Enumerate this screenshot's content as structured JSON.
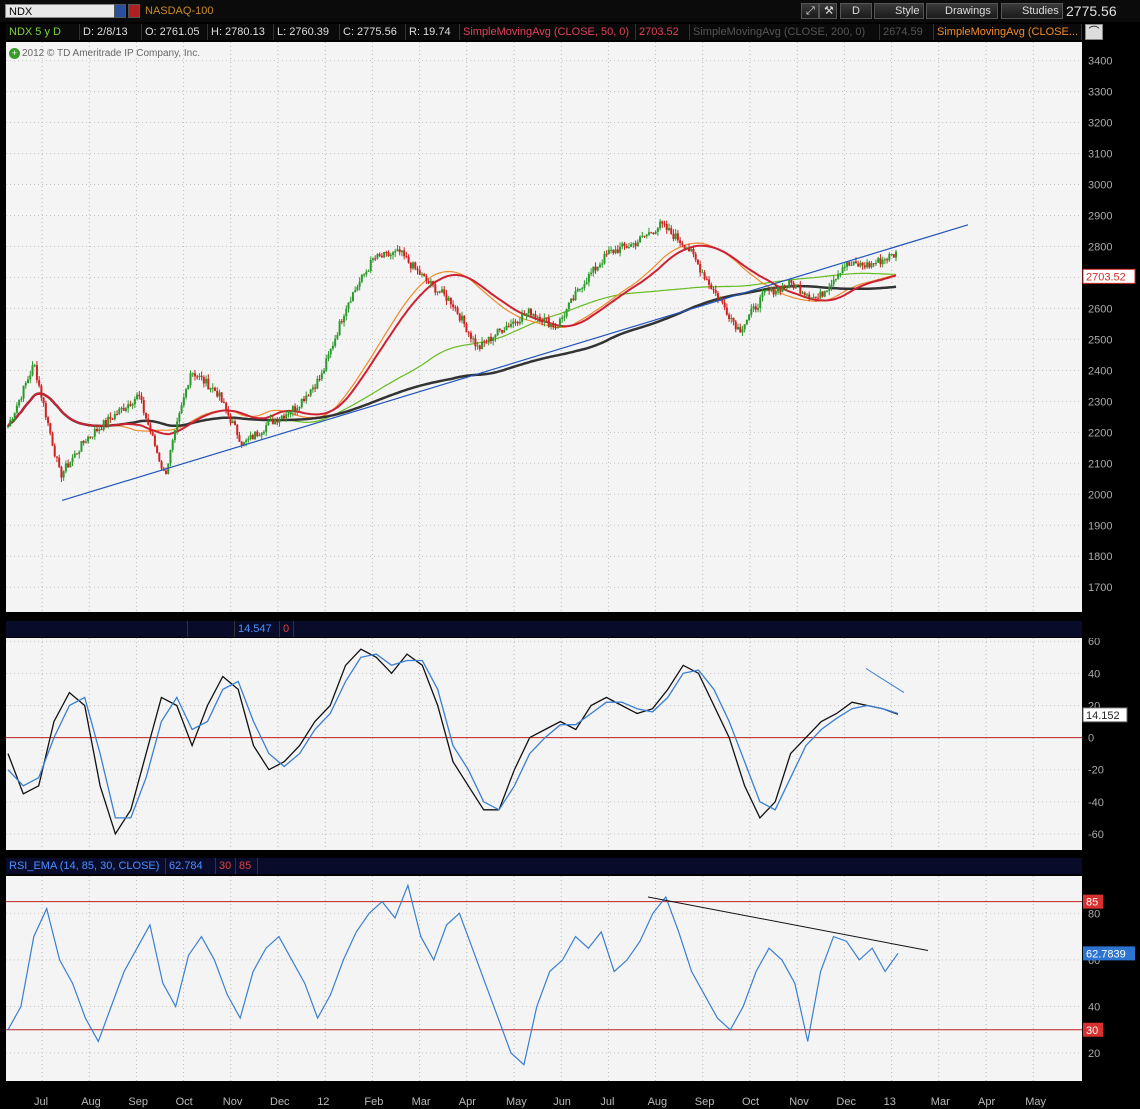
{
  "toolbar": {
    "symbol": "NDX",
    "symbol_name": "NASDAQ-100",
    "aggregation_btn": "D",
    "style_label": "Style",
    "drawings_label": "Drawings",
    "studies_label": "Studies",
    "last_price": "2775.56"
  },
  "quote_bar": {
    "symbol_period": "NDX 5 y D",
    "date": "D: 2/8/13",
    "open": "O: 2761.05",
    "high": "H: 2780.13",
    "low": "L: 2760.39",
    "close": "C: 2775.56",
    "range": "R: 19.74",
    "sma50_label": "SimpleMovingAvg (CLOSE, 50, 0)",
    "sma50_value": "2703.52",
    "sma200_label": "SimpleMovingAvg (CLOSE, 200, 0)",
    "sma200_value": "2674.59",
    "sma_extra_label": "SimpleMovingAvg (CLOSE..."
  },
  "copyright": "2012 © TD Ameritrade IP Company, Inc.",
  "osc_panel": {
    "value_label": "14.547",
    "zero_label": "0"
  },
  "rsi_panel": {
    "study": "RSI_EMA (14, 85, 30, CLOSE)",
    "value": "62.784",
    "lower": "30",
    "upper": "85"
  },
  "colors": {
    "background": "#f4f4f4",
    "sma50": "#cc2233",
    "sma200": "#333333",
    "sma_orange": "#f08a2c",
    "sma_green": "#66bb22",
    "trend": "#2255bb",
    "rsi": "#3a7fd0"
  },
  "chart_data": [
    {
      "type": "candlestick",
      "title": "NDX 5 y D",
      "x_labels": [
        "Jul",
        "Aug",
        "Sep",
        "Oct",
        "Nov",
        "Dec",
        "12",
        "Feb",
        "Mar",
        "Apr",
        "May",
        "Jun",
        "Jul",
        "Aug",
        "Sep",
        "Oct",
        "Nov",
        "Dec",
        "13",
        "Mar",
        "Apr",
        "May"
      ],
      "ylim": [
        1620,
        3460
      ],
      "yticks": [
        3400,
        3300,
        3200,
        3100,
        3000,
        2900,
        2800,
        2700,
        2600,
        2500,
        2400,
        2300,
        2200,
        2100,
        2000,
        1900,
        1800,
        1700
      ],
      "price_keypoints": [
        [
          "Jul",
          2220
        ],
        [
          "Jul",
          2420
        ],
        [
          "Aug",
          2060
        ],
        [
          "Aug",
          2180
        ],
        [
          "Sep",
          2250
        ],
        [
          "Sep",
          2320
        ],
        [
          "Oct",
          2060
        ],
        [
          "Oct",
          2400
        ],
        [
          "Nov",
          2330
        ],
        [
          "Nov",
          2160
        ],
        [
          "Dec",
          2230
        ],
        [
          "Dec",
          2280
        ],
        [
          "12",
          2380
        ],
        [
          "Feb",
          2620
        ],
        [
          "Mar",
          2760
        ],
        [
          "Mar",
          2780
        ],
        [
          "Apr",
          2690
        ],
        [
          "Apr",
          2620
        ],
        [
          "May",
          2470
        ],
        [
          "May",
          2540
        ],
        [
          "Jun",
          2590
        ],
        [
          "Jun",
          2540
        ],
        [
          "Jul",
          2680
        ],
        [
          "Jul",
          2780
        ],
        [
          "Aug",
          2810
        ],
        [
          "Sep",
          2870
        ],
        [
          "Sep",
          2800
        ],
        [
          "Oct",
          2660
        ],
        [
          "Oct",
          2530
        ],
        [
          "Nov",
          2650
        ],
        [
          "Nov",
          2680
        ],
        [
          "Dec",
          2630
        ],
        [
          "Dec",
          2740
        ],
        [
          "13",
          2740
        ],
        [
          "13",
          2776
        ]
      ],
      "overlays": [
        {
          "name": "SimpleMovingAvg (CLOSE, 50, 0)",
          "last": 2703.52
        },
        {
          "name": "SimpleMovingAvg (CLOSE, 200, 0)",
          "last": 2674.59
        }
      ],
      "price_marker": 2703.52
    },
    {
      "type": "line",
      "ylim": [
        -70,
        62
      ],
      "yticks": [
        60,
        40,
        20,
        0,
        -20,
        -40,
        -60
      ],
      "series": [
        {
          "values": [
            -10,
            -35,
            -30,
            10,
            28,
            20,
            -30,
            -60,
            -45,
            -10,
            25,
            20,
            -5,
            20,
            38,
            30,
            -5,
            -20,
            -15,
            -5,
            10,
            20,
            45,
            55,
            50,
            40,
            52,
            45,
            20,
            -15,
            -30,
            -45,
            -45,
            -20,
            0,
            5,
            10,
            5,
            20,
            25,
            20,
            15,
            18,
            30,
            45,
            40,
            20,
            0,
            -30,
            -50,
            -40,
            -10,
            0,
            10,
            15,
            22,
            20,
            18,
            14.5
          ]
        },
        {
          "values": [
            -20,
            -30,
            -25,
            0,
            20,
            25,
            -10,
            -50,
            -50,
            -25,
            10,
            25,
            5,
            10,
            30,
            35,
            10,
            -10,
            -18,
            -10,
            5,
            15,
            35,
            50,
            52,
            45,
            48,
            48,
            30,
            -5,
            -20,
            -40,
            -45,
            -30,
            -10,
            0,
            8,
            8,
            15,
            22,
            22,
            18,
            16,
            25,
            40,
            42,
            30,
            10,
            -15,
            -40,
            -45,
            -25,
            -5,
            5,
            12,
            18,
            20,
            18,
            15
          ]
        }
      ],
      "hlines": [
        0
      ],
      "value_marker": 14.152
    },
    {
      "type": "line",
      "ylim": [
        8,
        96
      ],
      "yticks": [
        20,
        40,
        60,
        80
      ],
      "series": [
        {
          "name": "RSI_EMA (14, 85, 30, CLOSE)",
          "values": [
            30,
            40,
            70,
            82,
            60,
            50,
            35,
            25,
            40,
            55,
            65,
            75,
            50,
            40,
            62,
            70,
            60,
            45,
            35,
            55,
            65,
            70,
            60,
            50,
            35,
            45,
            60,
            72,
            80,
            85,
            78,
            92,
            70,
            60,
            75,
            80,
            65,
            50,
            35,
            20,
            15,
            40,
            55,
            60,
            70,
            65,
            72,
            55,
            60,
            68,
            80,
            87,
            72,
            55,
            45,
            35,
            30,
            40,
            55,
            65,
            60,
            50,
            25,
            55,
            70,
            68,
            60,
            65,
            55,
            62.8
          ]
        }
      ],
      "hlines": [
        85,
        30
      ],
      "value_marker": 62.7839
    }
  ]
}
